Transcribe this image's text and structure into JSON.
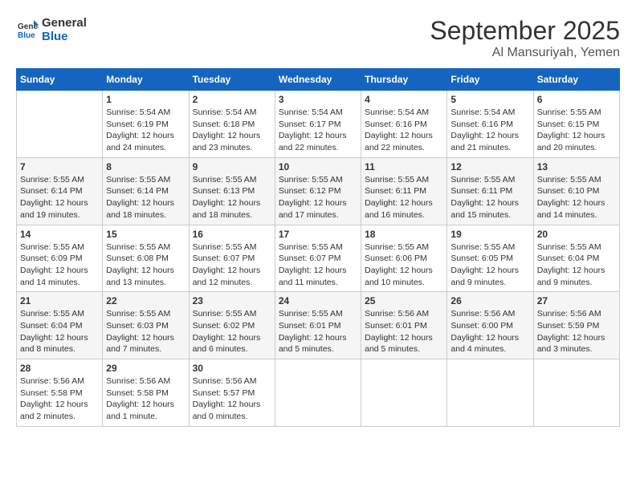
{
  "header": {
    "logo_line1": "General",
    "logo_line2": "Blue",
    "title": "September 2025",
    "subtitle": "Al Mansuriyah, Yemen"
  },
  "days_of_week": [
    "Sunday",
    "Monday",
    "Tuesday",
    "Wednesday",
    "Thursday",
    "Friday",
    "Saturday"
  ],
  "weeks": [
    [
      {
        "day": null,
        "info": null
      },
      {
        "day": "1",
        "info": "Sunrise: 5:54 AM\nSunset: 6:19 PM\nDaylight: 12 hours\nand 24 minutes."
      },
      {
        "day": "2",
        "info": "Sunrise: 5:54 AM\nSunset: 6:18 PM\nDaylight: 12 hours\nand 23 minutes."
      },
      {
        "day": "3",
        "info": "Sunrise: 5:54 AM\nSunset: 6:17 PM\nDaylight: 12 hours\nand 22 minutes."
      },
      {
        "day": "4",
        "info": "Sunrise: 5:54 AM\nSunset: 6:16 PM\nDaylight: 12 hours\nand 22 minutes."
      },
      {
        "day": "5",
        "info": "Sunrise: 5:54 AM\nSunset: 6:16 PM\nDaylight: 12 hours\nand 21 minutes."
      },
      {
        "day": "6",
        "info": "Sunrise: 5:55 AM\nSunset: 6:15 PM\nDaylight: 12 hours\nand 20 minutes."
      }
    ],
    [
      {
        "day": "7",
        "info": "Sunrise: 5:55 AM\nSunset: 6:14 PM\nDaylight: 12 hours\nand 19 minutes."
      },
      {
        "day": "8",
        "info": "Sunrise: 5:55 AM\nSunset: 6:14 PM\nDaylight: 12 hours\nand 18 minutes."
      },
      {
        "day": "9",
        "info": "Sunrise: 5:55 AM\nSunset: 6:13 PM\nDaylight: 12 hours\nand 18 minutes."
      },
      {
        "day": "10",
        "info": "Sunrise: 5:55 AM\nSunset: 6:12 PM\nDaylight: 12 hours\nand 17 minutes."
      },
      {
        "day": "11",
        "info": "Sunrise: 5:55 AM\nSunset: 6:11 PM\nDaylight: 12 hours\nand 16 minutes."
      },
      {
        "day": "12",
        "info": "Sunrise: 5:55 AM\nSunset: 6:11 PM\nDaylight: 12 hours\nand 15 minutes."
      },
      {
        "day": "13",
        "info": "Sunrise: 5:55 AM\nSunset: 6:10 PM\nDaylight: 12 hours\nand 14 minutes."
      }
    ],
    [
      {
        "day": "14",
        "info": "Sunrise: 5:55 AM\nSunset: 6:09 PM\nDaylight: 12 hours\nand 14 minutes."
      },
      {
        "day": "15",
        "info": "Sunrise: 5:55 AM\nSunset: 6:08 PM\nDaylight: 12 hours\nand 13 minutes."
      },
      {
        "day": "16",
        "info": "Sunrise: 5:55 AM\nSunset: 6:07 PM\nDaylight: 12 hours\nand 12 minutes."
      },
      {
        "day": "17",
        "info": "Sunrise: 5:55 AM\nSunset: 6:07 PM\nDaylight: 12 hours\nand 11 minutes."
      },
      {
        "day": "18",
        "info": "Sunrise: 5:55 AM\nSunset: 6:06 PM\nDaylight: 12 hours\nand 10 minutes."
      },
      {
        "day": "19",
        "info": "Sunrise: 5:55 AM\nSunset: 6:05 PM\nDaylight: 12 hours\nand 9 minutes."
      },
      {
        "day": "20",
        "info": "Sunrise: 5:55 AM\nSunset: 6:04 PM\nDaylight: 12 hours\nand 9 minutes."
      }
    ],
    [
      {
        "day": "21",
        "info": "Sunrise: 5:55 AM\nSunset: 6:04 PM\nDaylight: 12 hours\nand 8 minutes."
      },
      {
        "day": "22",
        "info": "Sunrise: 5:55 AM\nSunset: 6:03 PM\nDaylight: 12 hours\nand 7 minutes."
      },
      {
        "day": "23",
        "info": "Sunrise: 5:55 AM\nSunset: 6:02 PM\nDaylight: 12 hours\nand 6 minutes."
      },
      {
        "day": "24",
        "info": "Sunrise: 5:55 AM\nSunset: 6:01 PM\nDaylight: 12 hours\nand 5 minutes."
      },
      {
        "day": "25",
        "info": "Sunrise: 5:56 AM\nSunset: 6:01 PM\nDaylight: 12 hours\nand 5 minutes."
      },
      {
        "day": "26",
        "info": "Sunrise: 5:56 AM\nSunset: 6:00 PM\nDaylight: 12 hours\nand 4 minutes."
      },
      {
        "day": "27",
        "info": "Sunrise: 5:56 AM\nSunset: 5:59 PM\nDaylight: 12 hours\nand 3 minutes."
      }
    ],
    [
      {
        "day": "28",
        "info": "Sunrise: 5:56 AM\nSunset: 5:58 PM\nDaylight: 12 hours\nand 2 minutes."
      },
      {
        "day": "29",
        "info": "Sunrise: 5:56 AM\nSunset: 5:58 PM\nDaylight: 12 hours\nand 1 minute."
      },
      {
        "day": "30",
        "info": "Sunrise: 5:56 AM\nSunset: 5:57 PM\nDaylight: 12 hours\nand 0 minutes."
      },
      {
        "day": null,
        "info": null
      },
      {
        "day": null,
        "info": null
      },
      {
        "day": null,
        "info": null
      },
      {
        "day": null,
        "info": null
      }
    ]
  ]
}
